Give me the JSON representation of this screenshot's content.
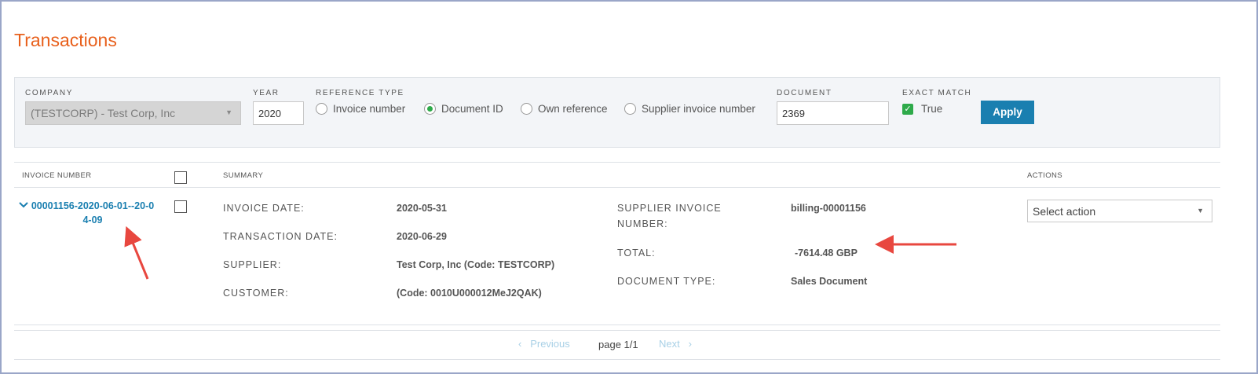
{
  "page": {
    "title": "Transactions"
  },
  "filters": {
    "company_label": "COMPANY",
    "company_value": "(TESTCORP) - Test Corp, Inc",
    "year_label": "YEAR",
    "year_value": "2020",
    "reference_type_label": "REFERENCE TYPE",
    "reference_types": [
      {
        "label": "Invoice number",
        "selected": false
      },
      {
        "label": "Document ID",
        "selected": true
      },
      {
        "label": "Own reference",
        "selected": false
      },
      {
        "label": "Supplier invoice number",
        "selected": false
      }
    ],
    "document_label": "DOCUMENT",
    "document_value": "2369",
    "exact_match_label": "EXACT MATCH",
    "exact_match_option": "True",
    "exact_match_checked": true,
    "apply_label": "Apply"
  },
  "table": {
    "headers": {
      "invoice_number": "INVOICE NUMBER",
      "summary": "SUMMARY",
      "actions": "ACTIONS"
    },
    "row": {
      "invoice_number_line1": "00001156-2020-06-01--20-0",
      "invoice_number_line2": "4-09",
      "invoice_date_label": "INVOICE DATE:",
      "invoice_date": "2020-05-31",
      "transaction_date_label": "TRANSACTION DATE:",
      "transaction_date": "2020-06-29",
      "supplier_label": "SUPPLIER:",
      "supplier": "Test Corp, Inc (Code: TESTCORP)",
      "customer_label": "CUSTOMER:",
      "customer": "(Code: 0010U000012MeJ2QAK)",
      "supplier_invoice_number_label_line1": "SUPPLIER INVOICE",
      "supplier_invoice_number_label_line2": "NUMBER:",
      "supplier_invoice_number": "billing-00001156",
      "total_label": "TOTAL:",
      "total": "-7614.48 GBP",
      "document_type_label": "DOCUMENT TYPE:",
      "document_type": "Sales Document",
      "action_placeholder": "Select action"
    }
  },
  "pager": {
    "previous_label": "Previous",
    "page_info": "page 1/1",
    "next_label": "Next"
  },
  "colors": {
    "accent_title": "#e8601c",
    "link": "#1a7fb0",
    "apply_button": "#1a7fb0",
    "check_green": "#2eaa4a",
    "annotation_arrow": "#e8473f"
  }
}
